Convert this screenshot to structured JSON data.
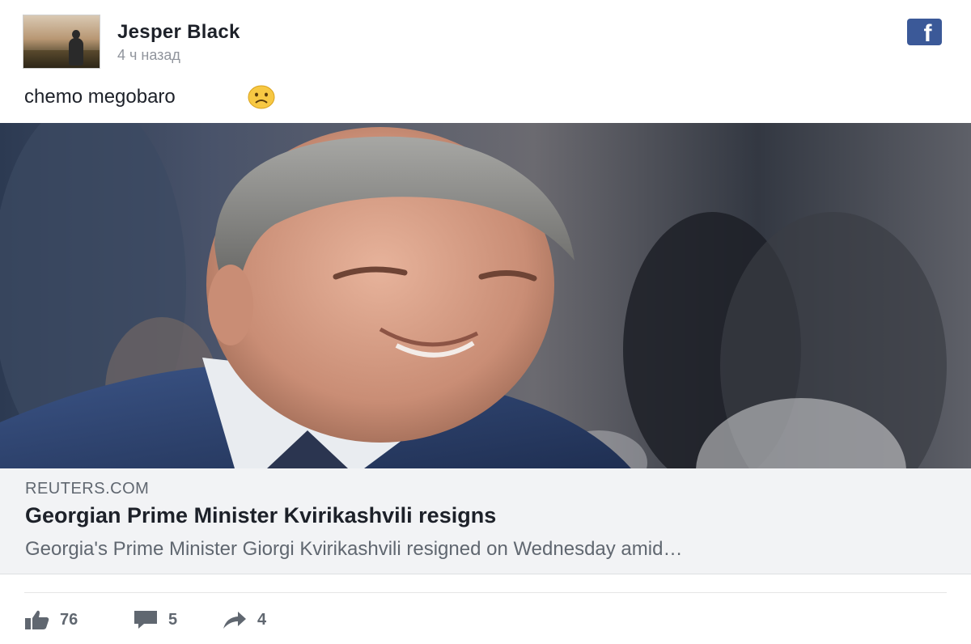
{
  "post": {
    "author": "Jesper Black",
    "time": "4 ч назад",
    "text": "chemo megobaro",
    "emoji": "sad-face-emoji"
  },
  "link": {
    "domain": "REUTERS.COM",
    "title": "Georgian Prime Minister Kvirikashvili resigns",
    "description": "Georgia's Prime Minister Giorgi Kvirikashvili resigned on Wednesday amid…"
  },
  "stats": {
    "likes": "76",
    "comments": "5",
    "shares": "4"
  },
  "icons": {
    "brand": "facebook-icon",
    "like": "thumbs-up-icon",
    "comment": "comment-icon",
    "share": "share-arrow-icon"
  },
  "colors": {
    "facebook_blue": "#3b5998",
    "text_primary": "#1d2129",
    "text_secondary": "#606770",
    "link_background": "#f2f3f5"
  }
}
